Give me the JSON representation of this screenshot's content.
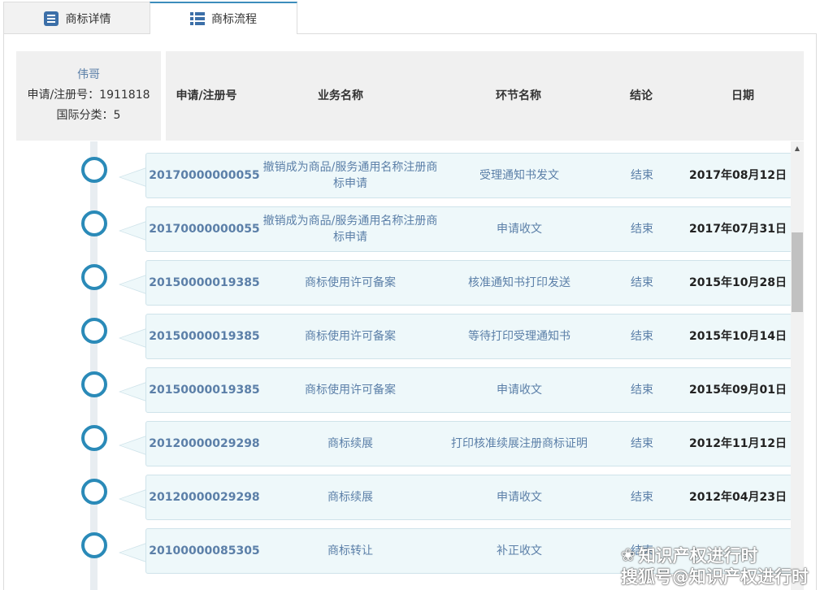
{
  "tabs": [
    {
      "label": "商标详情",
      "icon": "list-detail-icon",
      "active": false
    },
    {
      "label": "商标流程",
      "icon": "list-flow-icon",
      "active": true
    }
  ],
  "info": {
    "owner": "伟哥",
    "reg_line": "申请/注册号：1911818",
    "class_line": "国际分类：5"
  },
  "columns": [
    "申请/注册号",
    "业务名称",
    "环节名称",
    "结论",
    "日期"
  ],
  "rows": [
    {
      "no": "20170000000055",
      "business": "撤销成为商品/服务通用名称注册商标申请",
      "step": "受理通知书发文",
      "result": "结束",
      "date": "2017年08月12日"
    },
    {
      "no": "20170000000055",
      "business": "撤销成为商品/服务通用名称注册商标申请",
      "step": "申请收文",
      "result": "结束",
      "date": "2017年07月31日"
    },
    {
      "no": "20150000019385",
      "business": "商标使用许可备案",
      "step": "核准通知书打印发送",
      "result": "结束",
      "date": "2015年10月28日"
    },
    {
      "no": "20150000019385",
      "business": "商标使用许可备案",
      "step": "等待打印受理通知书",
      "result": "结束",
      "date": "2015年10月14日"
    },
    {
      "no": "20150000019385",
      "business": "商标使用许可备案",
      "step": "申请收文",
      "result": "结束",
      "date": "2015年09月01日"
    },
    {
      "no": "20120000029298",
      "business": "商标续展",
      "step": "打印核准续展注册商标证明",
      "result": "结束",
      "date": "2012年11月12日"
    },
    {
      "no": "20120000029298",
      "business": "商标续展",
      "step": "申请收文",
      "result": "结束",
      "date": "2012年04月23日"
    },
    {
      "no": "20100000085305",
      "business": "商标转让",
      "step": "补正收文",
      "result": "结束",
      "date": ""
    }
  ],
  "watermark": {
    "line1": "知识产权进行时",
    "line2": "搜狐号@知识产权进行时"
  },
  "colors": {
    "accent": "#2a8ab8",
    "link": "#5b7fa8",
    "card_bg": "#eef8fa"
  }
}
